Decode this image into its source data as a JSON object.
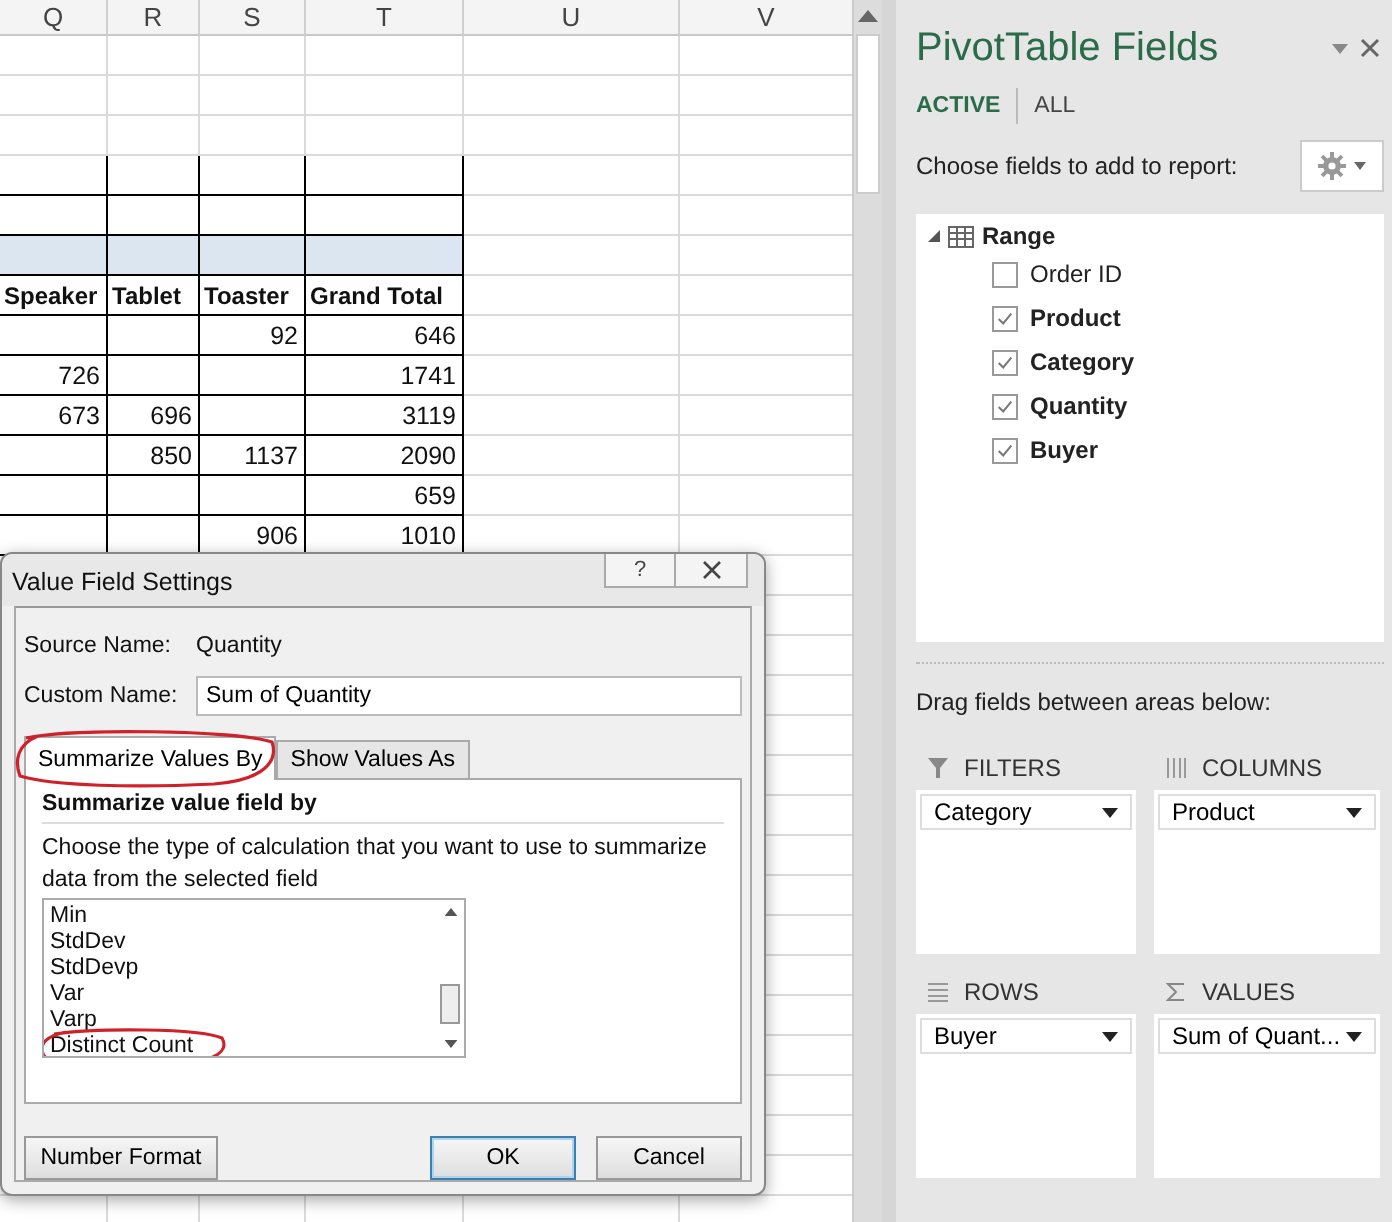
{
  "sheet": {
    "columns": [
      "Q",
      "R",
      "S",
      "T",
      "U",
      "V"
    ],
    "pivot_header": [
      "Speaker",
      "Tablet",
      "Toaster",
      "Grand Total"
    ],
    "pivot_rows": [
      [
        null,
        null,
        "92",
        "646"
      ],
      [
        "726",
        null,
        null,
        "1741"
      ],
      [
        "673",
        "696",
        null,
        "3119"
      ],
      [
        null,
        "850",
        "1137",
        "2090"
      ],
      [
        null,
        null,
        null,
        "659"
      ],
      [
        null,
        null,
        "906",
        "1010"
      ]
    ]
  },
  "dialog": {
    "title": "Value Field Settings",
    "help": "?",
    "source_label": "Source Name:",
    "source_value": "Quantity",
    "custom_label": "Custom Name:",
    "custom_value": "Sum of Quantity",
    "tabs": [
      {
        "label": "Summarize Values By",
        "selected": true,
        "highlighted": true
      },
      {
        "label": "Show Values As",
        "selected": false,
        "highlighted": false
      }
    ],
    "section_title": "Summarize value field by",
    "description": "Choose the type of calculation that you want to use to summarize data from the selected field",
    "functions": [
      {
        "label": "Min",
        "highlighted": false
      },
      {
        "label": "StdDev",
        "highlighted": false
      },
      {
        "label": "StdDevp",
        "highlighted": false
      },
      {
        "label": "Var",
        "highlighted": false
      },
      {
        "label": "Varp",
        "highlighted": false
      },
      {
        "label": "Distinct Count",
        "highlighted": true
      }
    ],
    "buttons": [
      {
        "label": "Number Format",
        "kind": "secondary"
      },
      {
        "label": "OK",
        "kind": "default"
      },
      {
        "label": "Cancel",
        "kind": "secondary"
      }
    ]
  },
  "pivot_fields": {
    "title": "PivotTable Fields",
    "tabs": [
      {
        "label": "ACTIVE",
        "selected": true
      },
      {
        "label": "ALL",
        "selected": false
      }
    ],
    "prompt": "Choose fields to add to report:",
    "tree": {
      "label": "Range",
      "expanded": true,
      "children": [
        {
          "label": "Order ID",
          "checked": false
        },
        {
          "label": "Product",
          "checked": true
        },
        {
          "label": "Category",
          "checked": true
        },
        {
          "label": "Quantity",
          "checked": true
        },
        {
          "label": "Buyer",
          "checked": true
        }
      ]
    },
    "areas_prompt": "Drag fields between areas below:",
    "areas": [
      {
        "kind": "filters",
        "label": "FILTERS",
        "fields": [
          "Category"
        ]
      },
      {
        "kind": "columns",
        "label": "COLUMNS",
        "fields": [
          "Product"
        ]
      },
      {
        "kind": "rows",
        "label": "ROWS",
        "fields": [
          "Buyer"
        ]
      },
      {
        "kind": "values",
        "label": "VALUES",
        "fields": [
          "Sum of Quant..."
        ]
      }
    ]
  }
}
